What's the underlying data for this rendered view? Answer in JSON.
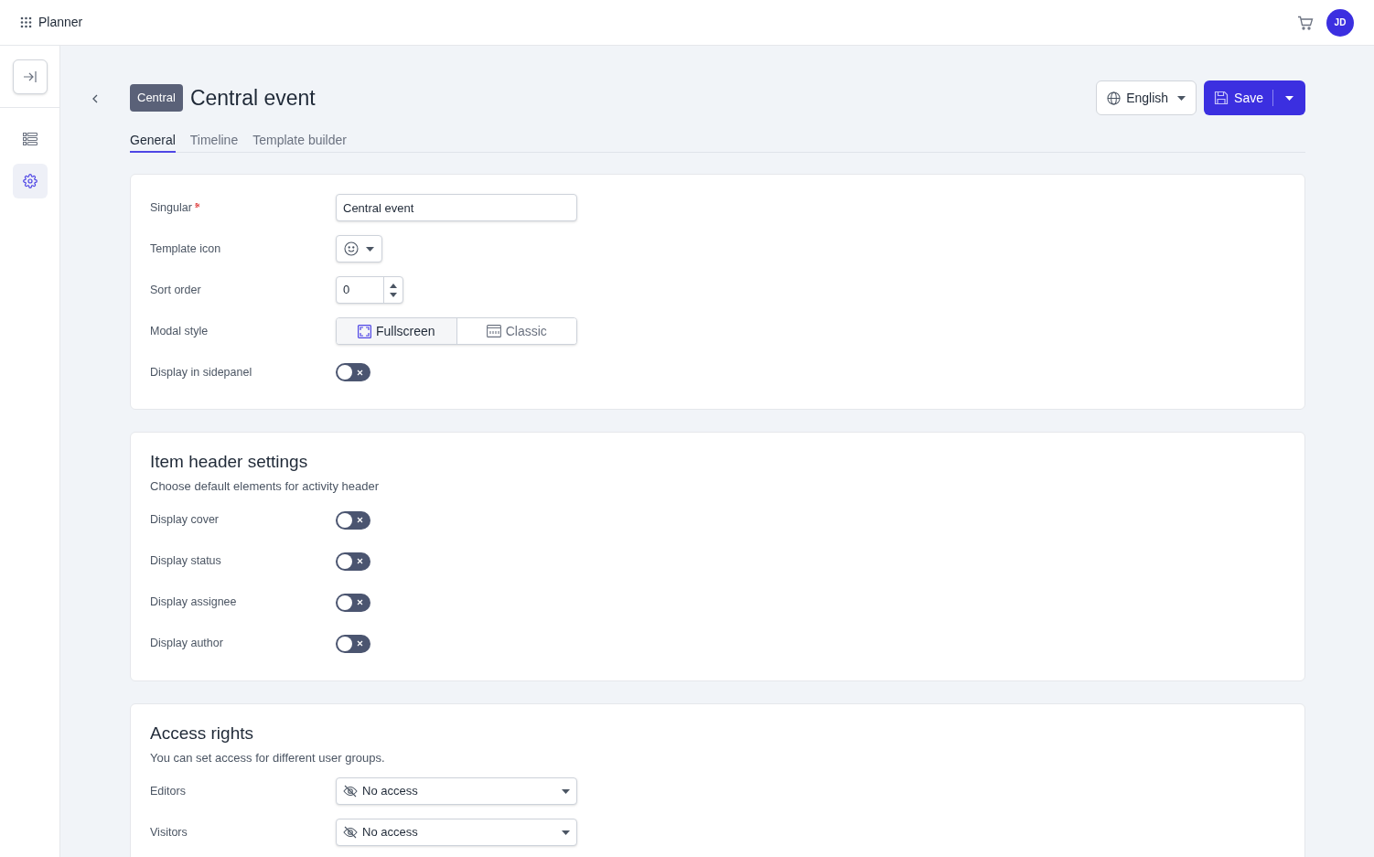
{
  "app": {
    "name": "Planner"
  },
  "user": {
    "initials": "JD"
  },
  "sidebar": {
    "items": [
      {
        "kind": "list",
        "selected": false
      },
      {
        "kind": "settings",
        "selected": true
      }
    ]
  },
  "header": {
    "badge": "Central",
    "title": "Central event",
    "language": "English",
    "save": "Save"
  },
  "tabs": [
    {
      "label": "General",
      "selected": true
    },
    {
      "label": "Timeline",
      "selected": false
    },
    {
      "label": "Template builder",
      "selected": false
    }
  ],
  "sections": [
    {
      "fields": [
        {
          "kind": "text",
          "label": "Singular",
          "required": true,
          "value": "Central event"
        },
        {
          "kind": "icon_select",
          "label": "Template icon"
        },
        {
          "kind": "number",
          "label": "Sort order",
          "value": "0"
        },
        {
          "kind": "segmented",
          "label": "Modal style",
          "options": [
            {
              "label": "Fullscreen",
              "selected": true
            },
            {
              "label": "Classic",
              "selected": false
            }
          ]
        },
        {
          "kind": "toggle",
          "label": "Display in sidepanel",
          "on": false
        }
      ]
    },
    {
      "title": "Item header settings",
      "subtitle": "Choose default elements for activity header",
      "fields": [
        {
          "kind": "toggle",
          "label": "Display cover",
          "on": false
        },
        {
          "kind": "toggle",
          "label": "Display status",
          "on": false
        },
        {
          "kind": "toggle",
          "label": "Display assignee",
          "on": false
        },
        {
          "kind": "toggle",
          "label": "Display author",
          "on": false
        }
      ]
    },
    {
      "title": "Access rights",
      "subtitle": "You can set access for different user groups.",
      "fields": [
        {
          "kind": "select",
          "label": "Editors",
          "value": "No access"
        },
        {
          "kind": "select",
          "label": "Visitors",
          "value": "No access"
        }
      ]
    }
  ]
}
